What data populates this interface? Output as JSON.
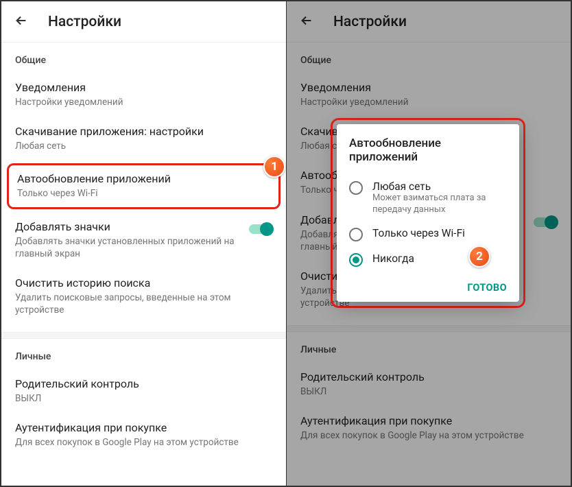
{
  "appbar": {
    "title": "Настройки"
  },
  "sections": {
    "general": "Общие",
    "personal": "Личные"
  },
  "items": {
    "notifications": {
      "title": "Уведомления",
      "sub": "Настройки уведомлений"
    },
    "download": {
      "title": "Скачивание приложения: настройки",
      "sub": "Любая сеть"
    },
    "autoupdate": {
      "title": "Автообновление приложений",
      "sub": "Только через Wi-Fi"
    },
    "icons": {
      "title": "Добавлять значки",
      "sub": "Добавлять значки установленных приложений на главный экран"
    },
    "clear_history": {
      "title": "Очистить историю поиска",
      "sub": "Удалить поисковые запросы, введенные на этом устройстве"
    },
    "parental": {
      "title": "Родительский контроль",
      "sub": "ВЫКЛ"
    },
    "auth": {
      "title": "Аутентификация при покупке",
      "sub": "Для всех покупок в Google Play на этом устройстве"
    }
  },
  "dialog": {
    "title": "Автообновление приложений",
    "options": {
      "any": {
        "label": "Любая сеть",
        "sub": "Может взиматься плата за передачу данных"
      },
      "wifi": {
        "label": "Только через Wi-Fi"
      },
      "never": {
        "label": "Никогда"
      }
    },
    "done": "ГОТОВО"
  },
  "markers": {
    "one": "1",
    "two": "2"
  }
}
